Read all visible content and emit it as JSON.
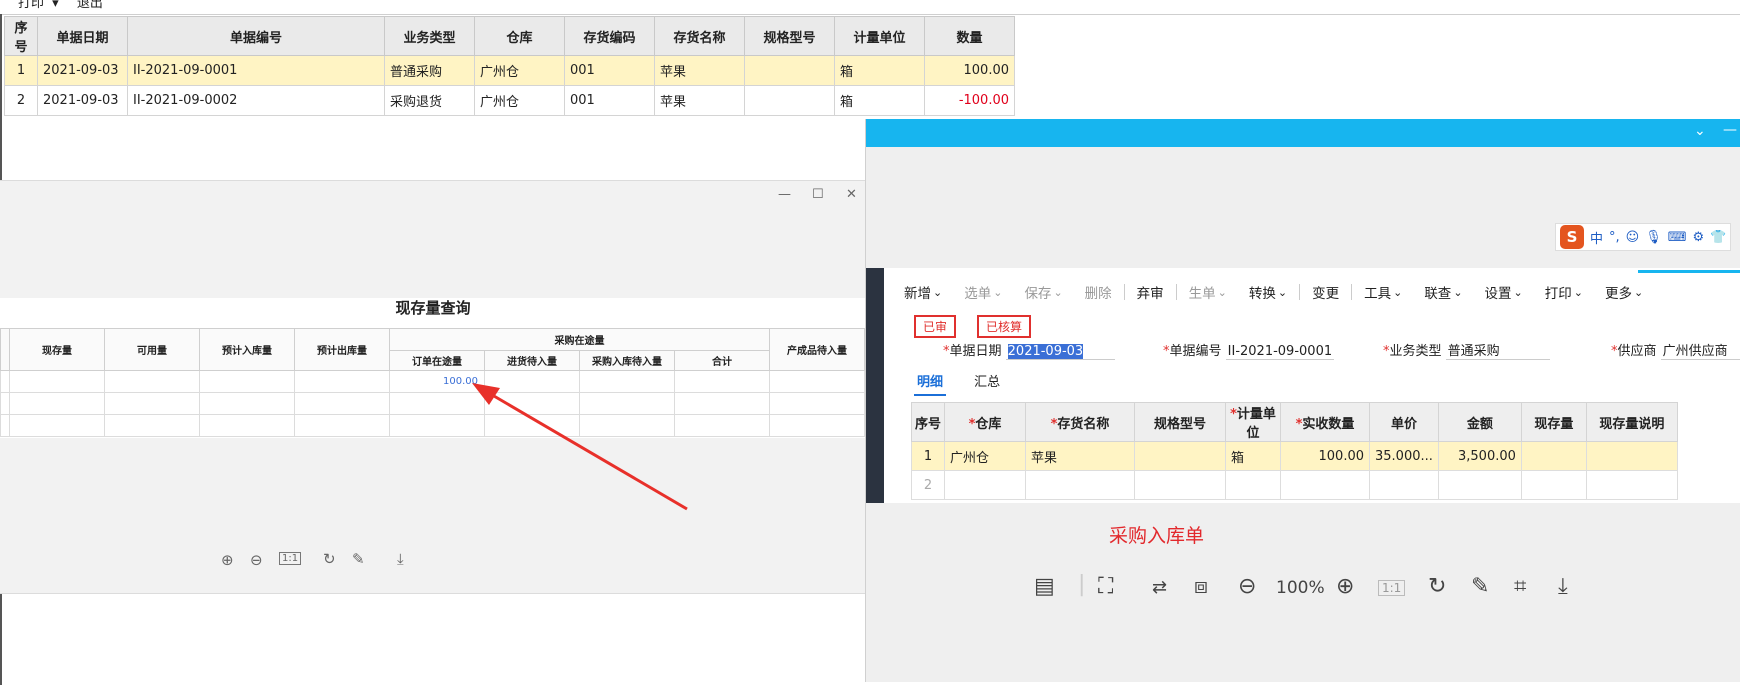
{
  "top_menu": {
    "print": "打印",
    "exit": "退出"
  },
  "main_table": {
    "headers": [
      "序号",
      "单据日期",
      "单据编号",
      "业务类型",
      "仓库",
      "存货编码",
      "存货名称",
      "规格型号",
      "计量单位",
      "数量"
    ],
    "rows": [
      [
        "1",
        "2021-09-03",
        "II-2021-09-0001",
        "普通采购",
        "广州仓",
        "001",
        "苹果",
        "",
        "箱",
        "100.00"
      ],
      [
        "2",
        "2021-09-03",
        "II-2021-09-0002",
        "采购退货",
        "广州仓",
        "001",
        "苹果",
        "",
        "箱",
        "-100.00"
      ]
    ]
  },
  "inventory_viewer": {
    "title": "现存量查询",
    "headers": [
      "现存量",
      "可用量",
      "预计入库量",
      "预计出库量",
      "采购在途量",
      "产成品待入量"
    ],
    "sub_headers": [
      "订单在途量",
      "进货待入量",
      "采购入库待入量",
      "合计"
    ],
    "cell_value": "100.00",
    "tools": [
      "zoom-in-icon",
      "zoom-out-icon",
      "actual-size-icon",
      "rotate-icon",
      "edit-icon",
      "download-icon"
    ]
  },
  "purchase_form": {
    "ime": {
      "logo": "S",
      "mode": "中"
    },
    "menu": [
      {
        "label": "新增",
        "gray": false,
        "arrow": true
      },
      {
        "label": "选单",
        "gray": true,
        "arrow": true
      },
      {
        "label": "保存",
        "gray": true,
        "arrow": true
      },
      {
        "label": "删除",
        "gray": true,
        "arrow": false
      },
      {
        "label": "弃审",
        "gray": false,
        "arrow": false
      },
      {
        "label": "生单",
        "gray": true,
        "arrow": true
      },
      {
        "label": "转换",
        "gray": false,
        "arrow": true
      },
      {
        "label": "变更",
        "gray": false,
        "arrow": false
      },
      {
        "label": "工具",
        "gray": false,
        "arrow": true
      },
      {
        "label": "联查",
        "gray": false,
        "arrow": true
      },
      {
        "label": "设置",
        "gray": false,
        "arrow": true
      },
      {
        "label": "打印",
        "gray": false,
        "arrow": true
      },
      {
        "label": "更多",
        "gray": false,
        "arrow": true
      }
    ],
    "stamps": [
      "已审",
      "已核算"
    ],
    "fields": {
      "date_label": "单据日期",
      "date_value": "2021-09-03",
      "code_label": "单据编号",
      "code_value": "II-2021-09-0001",
      "type_label": "业务类型",
      "type_value": "普通采购",
      "supplier_label": "供应商",
      "supplier_value": "广州供应商"
    },
    "tabs": [
      "明细",
      "汇总"
    ],
    "headers": [
      "序号",
      "仓库",
      "存货名称",
      "规格型号",
      "计量单位",
      "实收数量",
      "单价",
      "金额",
      "现存量",
      "现存量说明"
    ],
    "required_cols": [
      false,
      true,
      true,
      false,
      true,
      true,
      false,
      false,
      false,
      false
    ],
    "rows": [
      [
        "1",
        "广州仓",
        "苹果",
        "",
        "箱",
        "100.00",
        "35.000...",
        "3,500.00",
        "",
        ""
      ],
      [
        "2",
        "",
        "",
        "",
        "",
        "",
        "",
        "",
        "",
        ""
      ]
    ],
    "caption": "采购入库单",
    "zoom": "100%",
    "accent": "#17b5ef"
  }
}
